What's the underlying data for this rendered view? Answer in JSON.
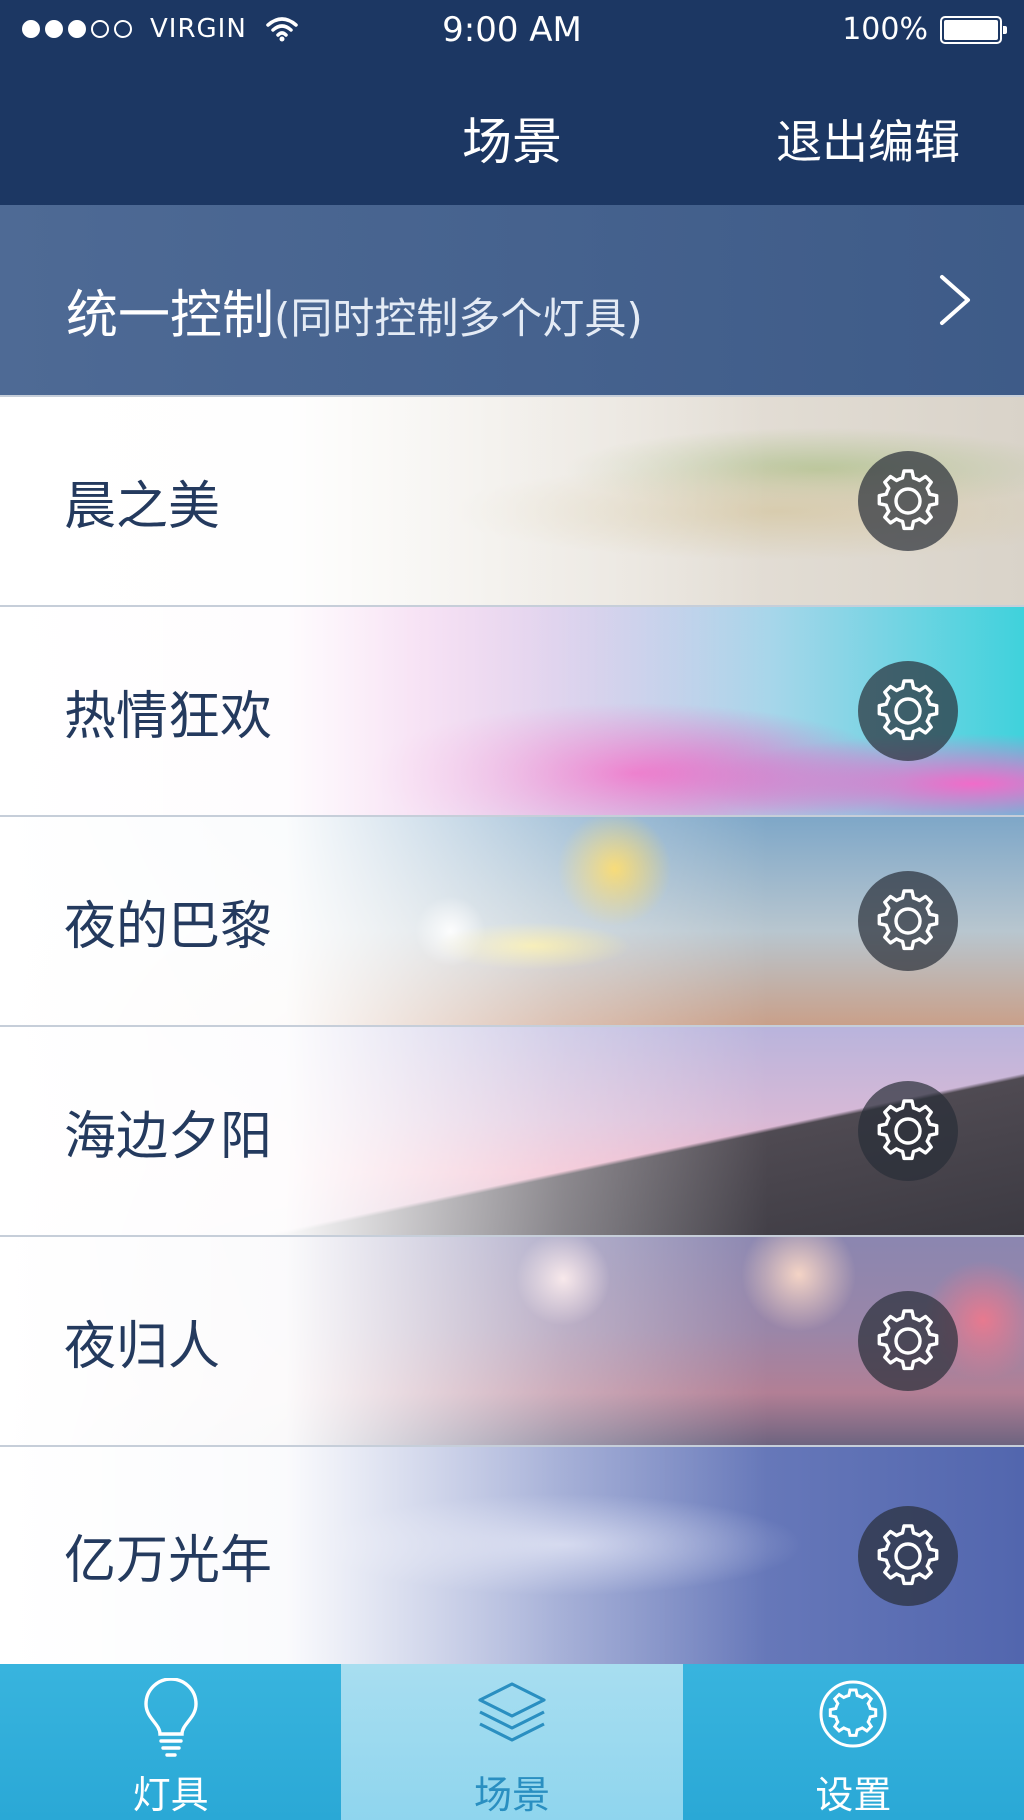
{
  "status_bar": {
    "carrier": "VIRGIN",
    "time": "9:00 AM",
    "battery": "100%",
    "signal_bars_filled": 3,
    "signal_bars_total": 5
  },
  "nav": {
    "title": "场景",
    "exit_label": "退出编辑"
  },
  "unified_control": {
    "title": "统一控制",
    "subtitle": "(同时控制多个灯具)",
    "arrow_icon": "chevron-right-icon"
  },
  "scenes": [
    {
      "name": "晨之美",
      "gear_icon": "gear-icon"
    },
    {
      "name": "热情狂欢",
      "gear_icon": "gear-icon"
    },
    {
      "name": "夜的巴黎",
      "gear_icon": "gear-icon"
    },
    {
      "name": "海边夕阳",
      "gear_icon": "gear-icon"
    },
    {
      "name": "夜归人",
      "gear_icon": "gear-icon"
    },
    {
      "name": "亿万光年",
      "gear_icon": "gear-icon"
    }
  ],
  "tabs": [
    {
      "label": "灯具",
      "icon": "bulb-icon",
      "active": false
    },
    {
      "label": "场景",
      "icon": "layers-icon",
      "active": true
    },
    {
      "label": "设置",
      "icon": "settings-icon",
      "active": false
    }
  ],
  "colors": {
    "nav_bg": "#1c3763",
    "unified_bg": "#4a6692",
    "tab_bg": "#31aedb",
    "tab_active_bg": "#9ad9ef",
    "scene_text": "#243a5e"
  }
}
